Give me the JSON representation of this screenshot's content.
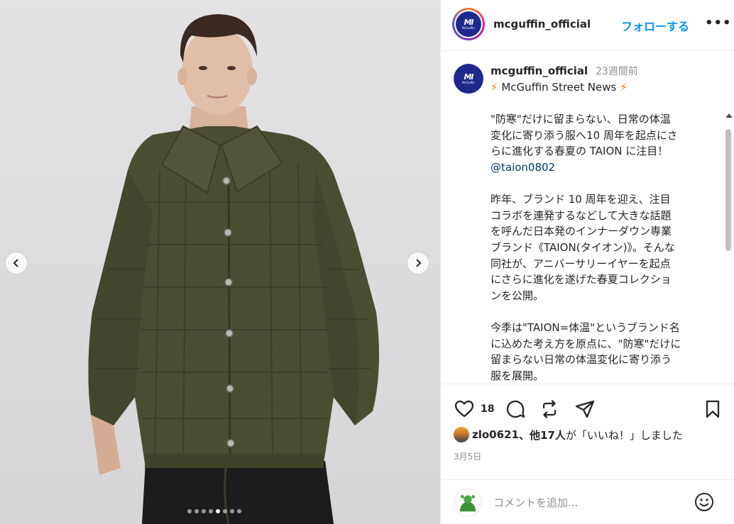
{
  "media": {
    "slide_count": 8,
    "active_slide": 5
  },
  "header": {
    "username": "mcguffin_official",
    "follow_label": "フォローする",
    "more_label": "•••",
    "logo_text": "MI",
    "logo_subtext": "McGuffin"
  },
  "caption": {
    "username": "mcguffin_official",
    "time_ago": "23週間前",
    "bolt": "⚡",
    "news_title": "McGuffin Street News",
    "lines_p1": [
      "\"防寒\"だけに留まらない、日常の体温",
      "変化に寄り添う服へ10 周年を起点にさ",
      "らに進化する春夏の TAION に注目！"
    ],
    "mention": "@taion0802",
    "lines_p2": [
      "昨年、ブランド 10 周年を迎え、注目",
      "コラボを連発するなどして大きな話題",
      "を呼んだ日本発のインナーダウン専業",
      "ブランド《TAION(タイオン)》。そんな",
      "同社が、アニバーサリーイヤーを起点",
      "にさらに進化を遂げた春夏コレクショ",
      "ンを公開。"
    ],
    "lines_p3": [
      "今季は\"TAION=体温\"というブランド名",
      "に込めた考え方を原点に、\"防寒\"だけに",
      "留まらない日常の体温変化に寄り添う",
      "服を展開。"
    ]
  },
  "actions": {
    "like_count": "18",
    "liked_by_user": "zlo0621",
    "liked_by_rest": "、他17人",
    "liked_by_suffix": "が「いいね！」しました",
    "date": "3月5日"
  },
  "comment": {
    "placeholder": "コメントを追加..."
  },
  "icons": {
    "like": "heart-icon",
    "comment": "comment-icon",
    "share": "repost-icon",
    "send": "send-icon",
    "save": "bookmark-icon",
    "emoji": "emoji-icon"
  }
}
